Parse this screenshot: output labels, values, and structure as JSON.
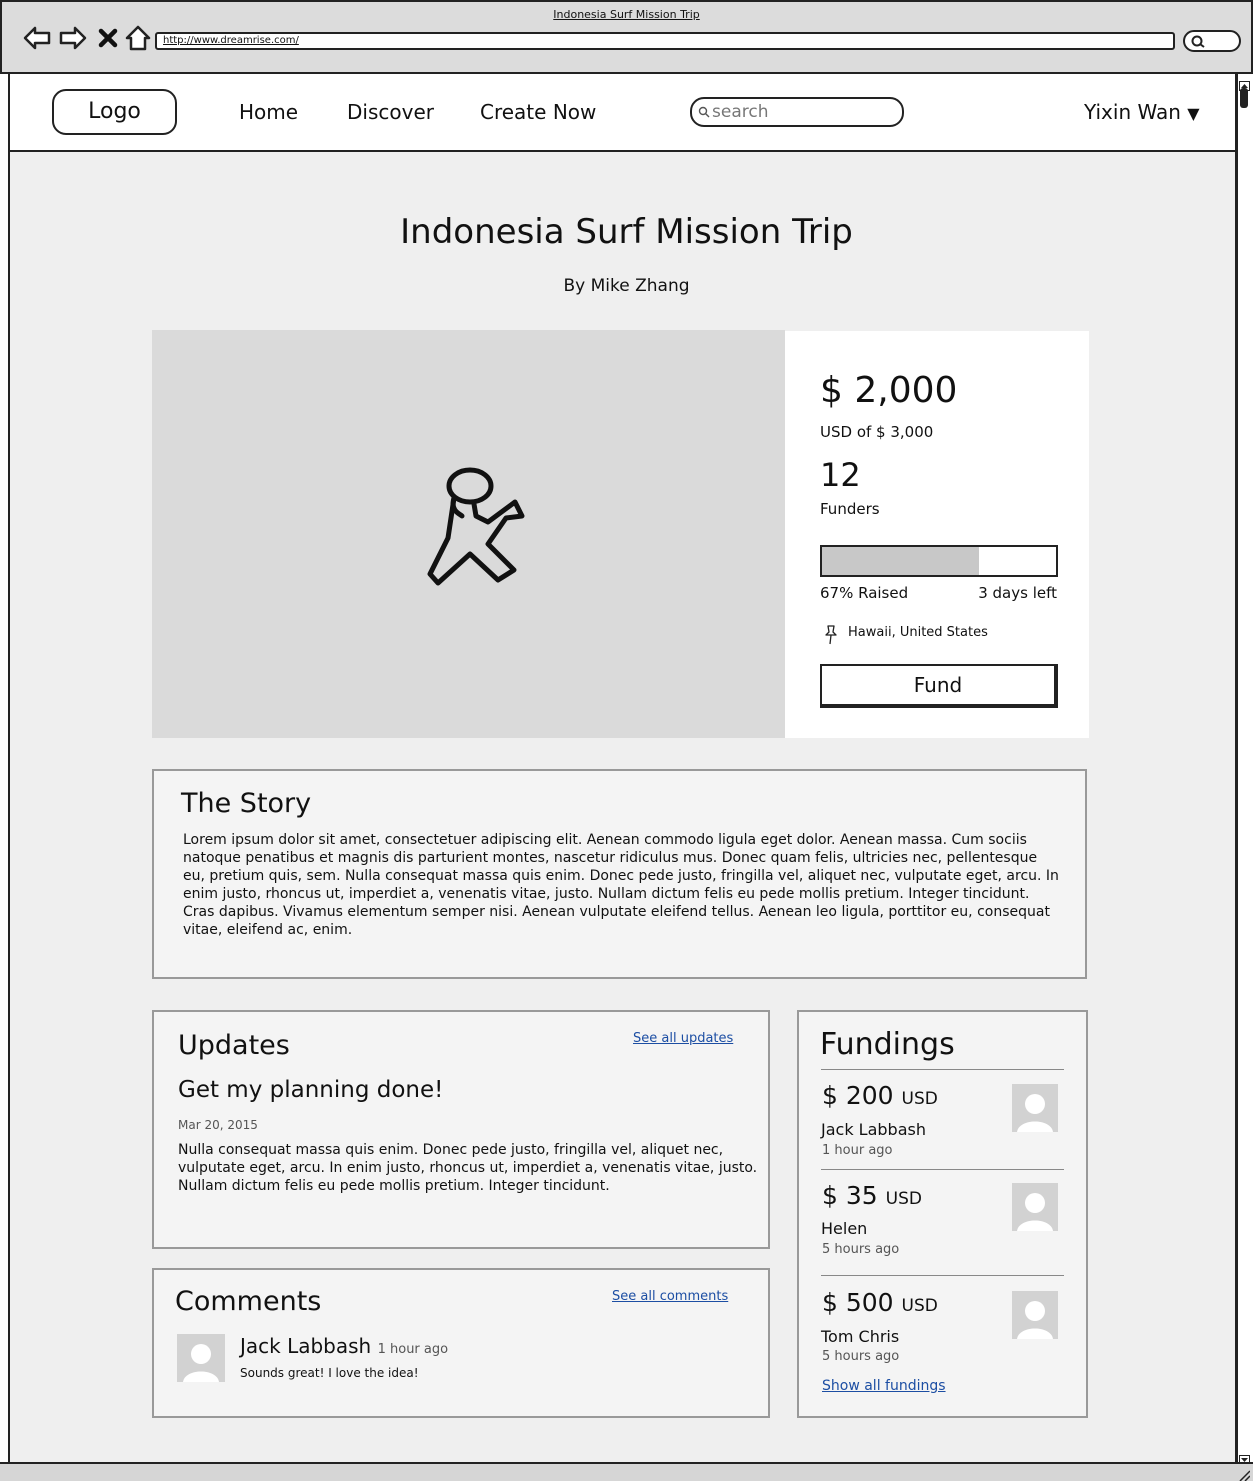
{
  "window": {
    "title": "Indonesia Surf Mission Trip",
    "url": "http://www.dreamrise.com/"
  },
  "header": {
    "logo": "Logo",
    "nav": [
      "Home",
      "Discover",
      "Create Now"
    ],
    "search_placeholder": "search",
    "user": "Yixin Wan",
    "user_caret": "▼"
  },
  "project": {
    "title": "Indonesia Surf Mission Trip",
    "author": "By Mike Zhang"
  },
  "funding": {
    "raised": "$ 2,000",
    "goal": "USD of $ 3,000",
    "funders_count": "12",
    "funders_label": "Funders",
    "progress_percent": 67,
    "percent_label": "67% Raised",
    "days_left": "3 days left",
    "location": "Hawaii, United States",
    "fund_button": "Fund"
  },
  "story": {
    "title": "The Story",
    "body": "Lorem ipsum dolor sit amet, consectetuer adipiscing elit. Aenean commodo ligula eget dolor. Aenean massa. Cum sociis natoque penatibus et magnis dis parturient montes, nascetur ridiculus mus. Donec quam felis, ultricies nec, pellentesque eu, pretium quis, sem. Nulla consequat massa quis enim. Donec pede justo, fringilla vel, aliquet nec, vulputate eget, arcu. In enim justo, rhoncus ut, imperdiet a, venenatis vitae, justo. Nullam dictum felis eu pede mollis pretium. Integer tincidunt. Cras dapibus. Vivamus elementum semper nisi. Aenean vulputate eleifend tellus. Aenean leo ligula, porttitor eu, consequat vitae, eleifend ac, enim."
  },
  "updates": {
    "title": "Updates",
    "see_all": "See all updates",
    "item": {
      "heading": "Get my planning done!",
      "date": "Mar 20, 2015",
      "body": "Nulla consequat massa quis enim. Donec pede justo, fringilla vel, aliquet nec, vulputate eget, arcu. In enim justo, rhoncus ut, imperdiet a, venenatis vitae, justo. Nullam dictum felis eu pede mollis pretium. Integer tincidunt."
    }
  },
  "comments": {
    "title": "Comments",
    "see_all": "See all comments",
    "item": {
      "author": "Jack Labbash",
      "time": "1 hour ago",
      "text": "Sounds great! I love the idea!"
    }
  },
  "fundings": {
    "title": "Fundings",
    "items": [
      {
        "amount": "$ 200",
        "currency": "USD",
        "name": "Jack Labbash",
        "time": "1 hour ago"
      },
      {
        "amount": "$ 35",
        "currency": "USD",
        "name": "Helen",
        "time": "5 hours ago"
      },
      {
        "amount": "$ 500",
        "currency": "USD",
        "name": "Tom Chris",
        "time": "5 hours ago"
      }
    ],
    "show_all": "Show all fundings"
  },
  "colors": {
    "link": "#1c4ea3",
    "progress_fill": "#c8c8c8",
    "page_background": "#efefef",
    "hero_placeholder": "#dadada"
  },
  "icons": {
    "back": "arrow-left-icon",
    "forward": "arrow-right-icon",
    "stop": "close-icon",
    "home": "home-icon",
    "search": "search-icon",
    "hero": "running-figure-icon",
    "location": "pin-icon",
    "avatar": "user-avatar-icon"
  }
}
